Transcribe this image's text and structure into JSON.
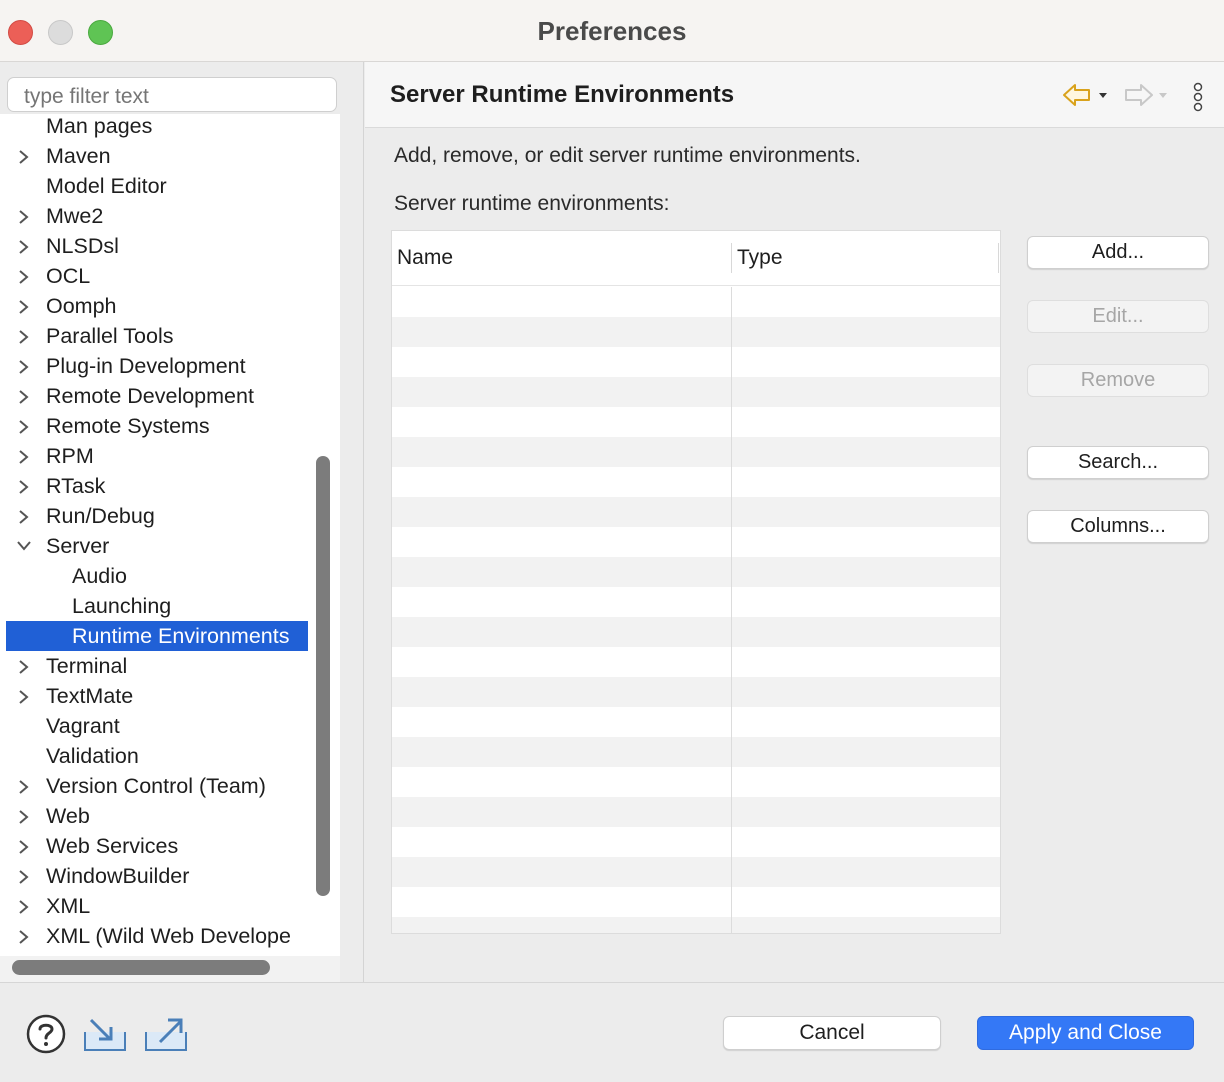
{
  "window": {
    "title": "Preferences"
  },
  "sidebar": {
    "filter_placeholder": "type filter text",
    "tree_items": [
      {
        "label": "Man pages",
        "expander": "none",
        "indent": 0
      },
      {
        "label": "Maven",
        "expander": "collapsed",
        "indent": 0
      },
      {
        "label": "Model Editor",
        "expander": "none",
        "indent": 0
      },
      {
        "label": "Mwe2",
        "expander": "collapsed",
        "indent": 0
      },
      {
        "label": "NLSDsl",
        "expander": "collapsed",
        "indent": 0
      },
      {
        "label": "OCL",
        "expander": "collapsed",
        "indent": 0
      },
      {
        "label": "Oomph",
        "expander": "collapsed",
        "indent": 0
      },
      {
        "label": "Parallel Tools",
        "expander": "collapsed",
        "indent": 0
      },
      {
        "label": "Plug-in Development",
        "expander": "collapsed",
        "indent": 0
      },
      {
        "label": "Remote Development",
        "expander": "collapsed",
        "indent": 0
      },
      {
        "label": "Remote Systems",
        "expander": "collapsed",
        "indent": 0
      },
      {
        "label": "RPM",
        "expander": "collapsed",
        "indent": 0
      },
      {
        "label": "RTask",
        "expander": "collapsed",
        "indent": 0
      },
      {
        "label": "Run/Debug",
        "expander": "collapsed",
        "indent": 0
      },
      {
        "label": "Server",
        "expander": "expanded",
        "indent": 0
      },
      {
        "label": "Audio",
        "expander": "none",
        "indent": 1
      },
      {
        "label": "Launching",
        "expander": "none",
        "indent": 1
      },
      {
        "label": "Runtime Environments",
        "expander": "none",
        "indent": 1,
        "selected": true
      },
      {
        "label": "Terminal",
        "expander": "collapsed",
        "indent": 0
      },
      {
        "label": "TextMate",
        "expander": "collapsed",
        "indent": 0
      },
      {
        "label": "Vagrant",
        "expander": "none",
        "indent": 0
      },
      {
        "label": "Validation",
        "expander": "none",
        "indent": 0
      },
      {
        "label": "Version Control (Team)",
        "expander": "collapsed",
        "indent": 0
      },
      {
        "label": "Web",
        "expander": "collapsed",
        "indent": 0
      },
      {
        "label": "Web Services",
        "expander": "collapsed",
        "indent": 0
      },
      {
        "label": "WindowBuilder",
        "expander": "collapsed",
        "indent": 0
      },
      {
        "label": "XML",
        "expander": "collapsed",
        "indent": 0
      },
      {
        "label": "XML (Wild Web Develope",
        "expander": "collapsed",
        "indent": 0
      }
    ]
  },
  "page": {
    "title": "Server Runtime Environments",
    "nav_icons": [
      "back-arrow-icon",
      "forward-arrow-icon",
      "more-options-icon"
    ],
    "description": "Add, remove, or edit server runtime environments.",
    "list_label": "Server runtime environments:",
    "table": {
      "columns": [
        "Name",
        "Type"
      ],
      "rows": []
    },
    "buttons": {
      "add": "Add...",
      "edit": "Edit...",
      "remove": "Remove",
      "search": "Search...",
      "columns": "Columns..."
    }
  },
  "footer": {
    "icons": [
      "help-icon",
      "import-icon",
      "export-icon"
    ],
    "cancel": "Cancel",
    "apply_close": "Apply and Close"
  },
  "colors": {
    "selection": "#2060d6",
    "primary_button": "#3478f6",
    "back_arrow": "#d9a21c"
  }
}
